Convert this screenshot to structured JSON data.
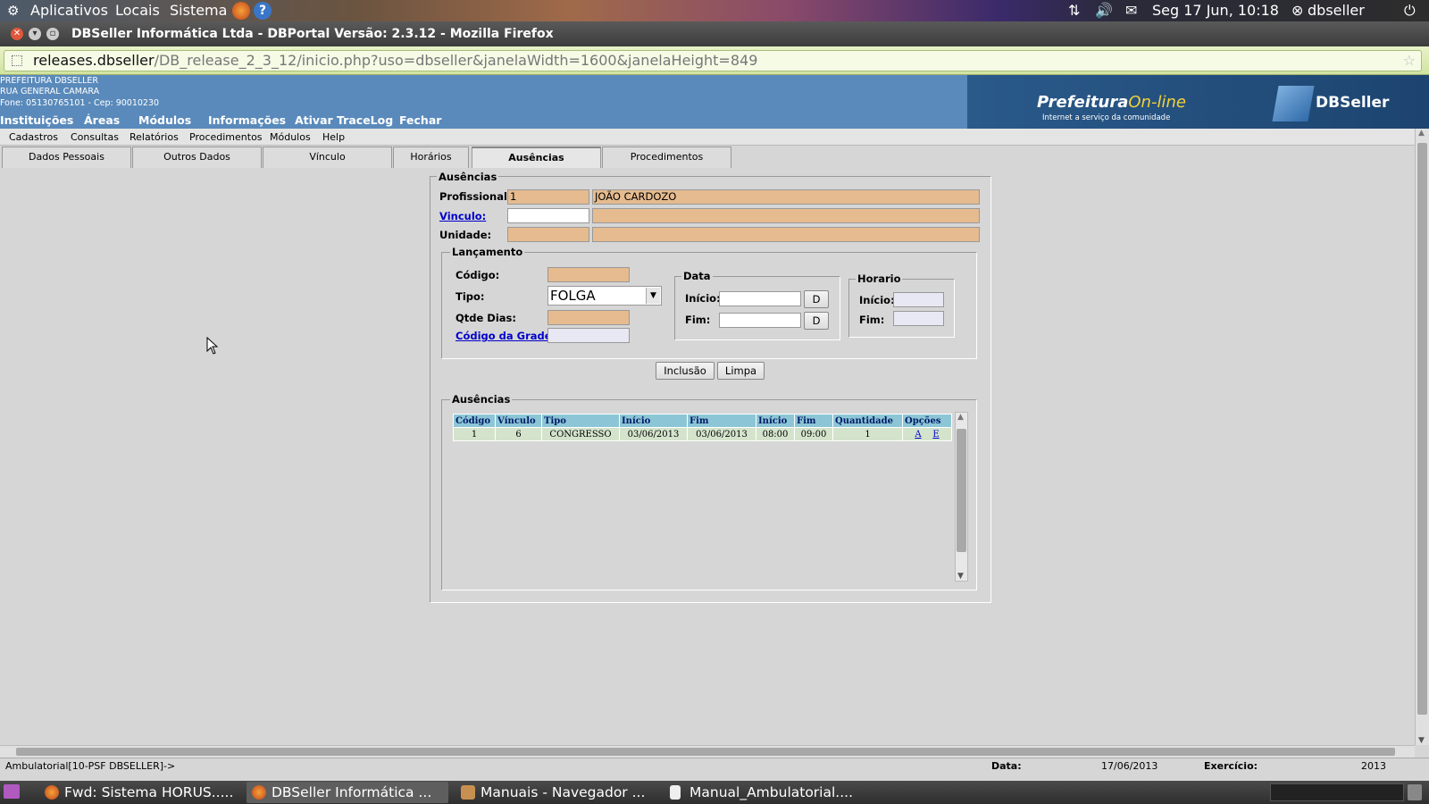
{
  "system_bar": {
    "menus": [
      "Aplicativos",
      "Locais",
      "Sistema"
    ],
    "clock": "Seg 17 Jun, 10:18",
    "user": "dbseller"
  },
  "window": {
    "title": "DBSeller Informática Ltda - DBPortal Versão: 2.3.12 - Mozilla Firefox"
  },
  "browser": {
    "url_host": "releases.dbseller",
    "url_path": "/DB_release_2_3_12/inicio.php?uso=dbseller&janelaWidth=1600&janelaHeight=849"
  },
  "header": {
    "org_name": "PREFEITURA DBSELLER",
    "street": "RUA GENERAL CAMARA",
    "phone": "Fone: 05130765101  -  Cep: 90010230",
    "main_menu": [
      "Instituições",
      "Áreas",
      "Módulos",
      "Informações",
      "Ativar TraceLog",
      "Fechar"
    ],
    "logo_title_1": "Prefeitura",
    "logo_title_2": "On-line",
    "logo_tagline": "Internet a serviço da comunidade",
    "brand": "DBSeller"
  },
  "submenu": [
    "Cadastros",
    "Consultas",
    "Relatórios",
    "Procedimentos",
    "Módulos",
    "Help"
  ],
  "tabs": [
    "Dados Pessoais",
    "Outros Dados",
    "Vínculo",
    "Horários",
    "Ausências",
    "Procedimentos"
  ],
  "form": {
    "legend": "Ausências",
    "profissional_label": "Profissional:",
    "profissional_code": "1",
    "profissional_name": "JOÃO CARDOZO",
    "vinculo_label": "Vinculo:",
    "vinculo_value": "",
    "unidade_label": "Unidade:",
    "lancamento": {
      "legend": "Lançamento",
      "codigo_label": "Código:",
      "tipo_label": "Tipo:",
      "tipo_value": "FOLGA",
      "qtde_label": "Qtde Dias:",
      "grade_label": "Código da Grade:",
      "data": {
        "legend": "Data",
        "inicio_label": "Início:",
        "fim_label": "Fim:",
        "button": "D"
      },
      "horario": {
        "legend": "Horario",
        "inicio_label": "Início:",
        "fim_label": "Fim:"
      }
    },
    "buttons": {
      "include": "Inclusão",
      "clear": "Limpa"
    }
  },
  "grid": {
    "legend": "Ausências",
    "columns": [
      "Código",
      "Vínculo",
      "Tipo",
      "Início",
      "Fim",
      "Início",
      "Fim",
      "Quantidade",
      "Opções"
    ],
    "rows": [
      {
        "codigo": "1",
        "vinculo": "6",
        "tipo": "CONGRESSO",
        "inicio": "03/06/2013",
        "fim": "03/06/2013",
        "hora_inicio": "08:00",
        "hora_fim": "09:00",
        "quantidade": "1",
        "opt_a": "A",
        "opt_e": "E"
      }
    ]
  },
  "status": {
    "module": "Ambulatorial[10-PSF DBSELLER]->",
    "date_label": "Data:",
    "date_value": "17/06/2013",
    "year_label": "Exercício:",
    "year_value": "2013"
  },
  "taskbar": [
    {
      "label": "Fwd: Sistema HORUS.....",
      "icon": "firefox-icon"
    },
    {
      "label": "DBSeller Informática ...",
      "icon": "firefox-icon",
      "active": true
    },
    {
      "label": "Manuais - Navegador ...",
      "icon": "folder-icon"
    },
    {
      "label": "Manual_Ambulatorial....",
      "icon": "document-icon"
    }
  ]
}
